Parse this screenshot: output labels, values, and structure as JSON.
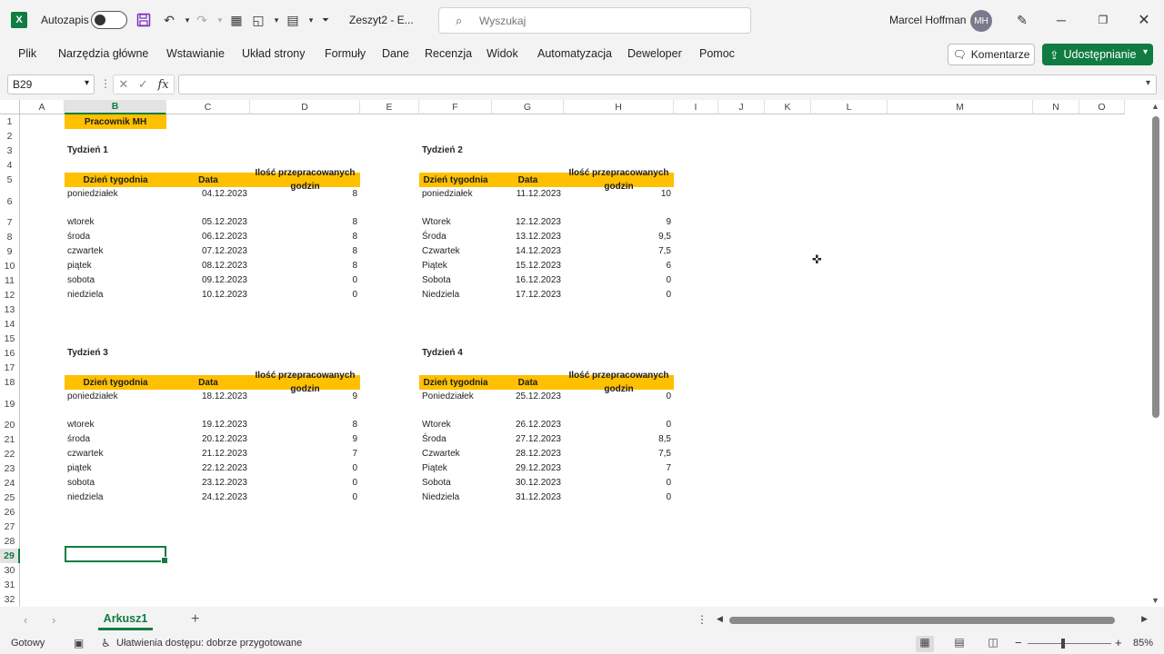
{
  "titlebar": {
    "autosave_label": "Autozapis",
    "doc_title": "Zeszyt2 - E...",
    "search_placeholder": "Wyszukaj",
    "user_name": "Marcel Hoffman",
    "user_initials": "MH"
  },
  "ribbon": {
    "tabs": [
      "Plik",
      "Narzędzia główne",
      "Wstawianie",
      "Układ strony",
      "Formuły",
      "Dane",
      "Recenzja",
      "Widok",
      "Automatyzacja",
      "Deweloper",
      "Pomoc"
    ],
    "comments_label": "Komentarze",
    "share_label": "Udostępnianie"
  },
  "formula_bar": {
    "name_box": "B29",
    "fx_label": "fx",
    "formula": ""
  },
  "columns": [
    "A",
    "B",
    "C",
    "D",
    "E",
    "F",
    "G",
    "H",
    "I",
    "J",
    "K",
    "L",
    "M",
    "N",
    "O"
  ],
  "selected_column": "B",
  "rows": [
    "1",
    "2",
    "3",
    "4",
    "5",
    "6",
    "7",
    "8",
    "9",
    "10",
    "11",
    "12",
    "13",
    "14",
    "15",
    "16",
    "17",
    "18",
    "19",
    "20",
    "21",
    "22",
    "23",
    "24",
    "25",
    "26",
    "27",
    "28",
    "29",
    "30",
    "31",
    "32"
  ],
  "selected_row": "29",
  "sheet": {
    "title": "Pracownik MH",
    "header": {
      "day": "Dzień tygodnia",
      "date": "Data",
      "hours": "Ilość przepracowanych godzin"
    },
    "weeks": [
      {
        "label": "Tydzień 1",
        "rows": [
          {
            "day": "poniedziałek",
            "date": "04.12.2023",
            "hours": "8"
          },
          {
            "day": "wtorek",
            "date": "05.12.2023",
            "hours": "8"
          },
          {
            "day": "środa",
            "date": "06.12.2023",
            "hours": "8"
          },
          {
            "day": "czwartek",
            "date": "07.12.2023",
            "hours": "8"
          },
          {
            "day": "piątek",
            "date": "08.12.2023",
            "hours": "8"
          },
          {
            "day": "sobota",
            "date": "09.12.2023",
            "hours": "0"
          },
          {
            "day": "niedziela",
            "date": "10.12.2023",
            "hours": "0"
          }
        ]
      },
      {
        "label": "Tydzień 2",
        "rows": [
          {
            "day": "poniedziałek",
            "date": "11.12.2023",
            "hours": "10"
          },
          {
            "day": "Wtorek",
            "date": "12.12.2023",
            "hours": "9"
          },
          {
            "day": "Środa",
            "date": "13.12.2023",
            "hours": "9,5"
          },
          {
            "day": "Czwartek",
            "date": "14.12.2023",
            "hours": "7,5"
          },
          {
            "day": "Piątek",
            "date": "15.12.2023",
            "hours": "6"
          },
          {
            "day": "Sobota",
            "date": "16.12.2023",
            "hours": "0"
          },
          {
            "day": "Niedziela",
            "date": "17.12.2023",
            "hours": "0"
          }
        ]
      },
      {
        "label": "Tydzień 3",
        "rows": [
          {
            "day": "poniedziałek",
            "date": "18.12.2023",
            "hours": "9"
          },
          {
            "day": "wtorek",
            "date": "19.12.2023",
            "hours": "8"
          },
          {
            "day": "środa",
            "date": "20.12.2023",
            "hours": "9"
          },
          {
            "day": "czwartek",
            "date": "21.12.2023",
            "hours": "7"
          },
          {
            "day": "piątek",
            "date": "22.12.2023",
            "hours": "0"
          },
          {
            "day": "sobota",
            "date": "23.12.2023",
            "hours": "0"
          },
          {
            "day": "niedziela",
            "date": "24.12.2023",
            "hours": "0"
          }
        ]
      },
      {
        "label": "Tydzień 4",
        "rows": [
          {
            "day": "Poniedziałek",
            "date": "25.12.2023",
            "hours": "0"
          },
          {
            "day": "Wtorek",
            "date": "26.12.2023",
            "hours": "0"
          },
          {
            "day": "Środa",
            "date": "27.12.2023",
            "hours": "8,5"
          },
          {
            "day": "Czwartek",
            "date": "28.12.2023",
            "hours": "7,5"
          },
          {
            "day": "Piątek",
            "date": "29.12.2023",
            "hours": "7"
          },
          {
            "day": "Sobota",
            "date": "30.12.2023",
            "hours": "0"
          },
          {
            "day": "Niedziela",
            "date": "31.12.2023",
            "hours": "0"
          }
        ]
      }
    ]
  },
  "sheet_tabs": {
    "active": "Arkusz1"
  },
  "status": {
    "ready": "Gotowy",
    "accessibility": "Ułatwienia dostępu: dobrze przygotowane",
    "zoom": "85%"
  },
  "colors": {
    "accent": "#107c41",
    "header_fill": "#ffc000"
  }
}
